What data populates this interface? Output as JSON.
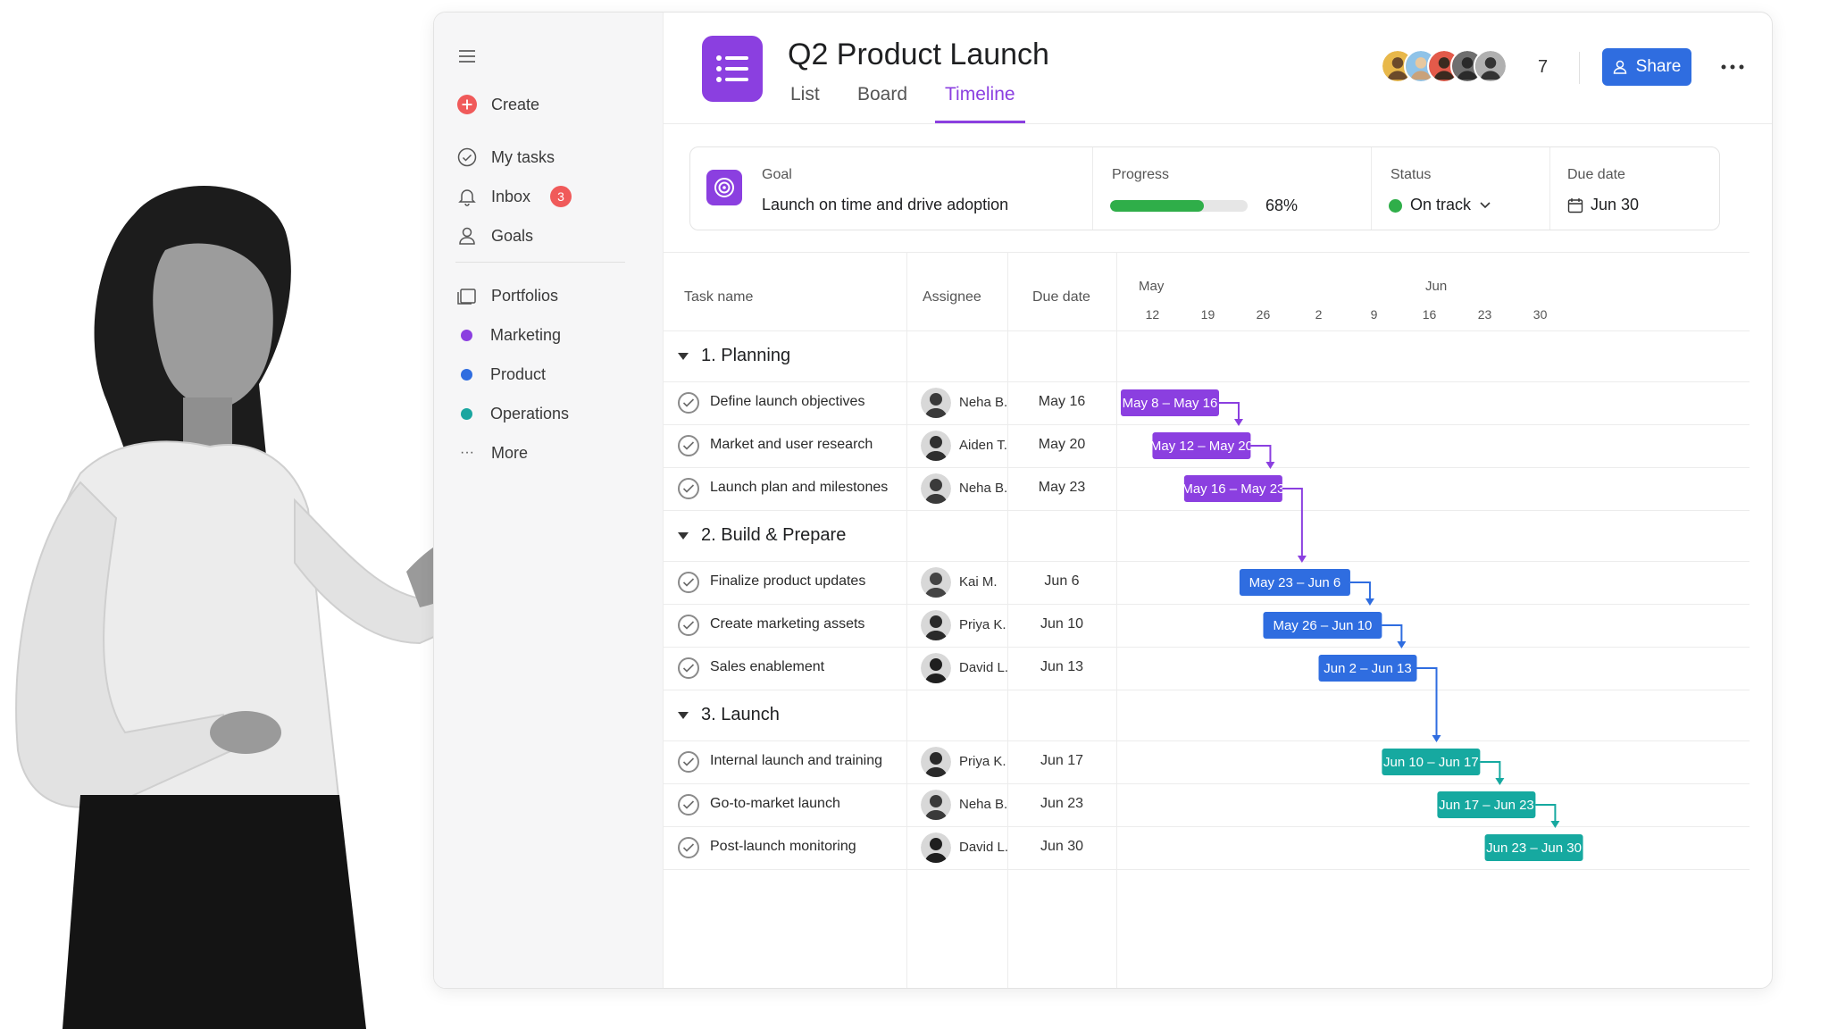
{
  "sidebar": {
    "create_label": "Create",
    "nav": [
      {
        "label": "My tasks",
        "icon": "check-circle-icon"
      },
      {
        "label": "Inbox",
        "icon": "bell-icon",
        "badge": "3"
      },
      {
        "label": "Goals",
        "icon": "person-icon"
      }
    ],
    "portfolios_label": "Portfolios",
    "teams": [
      {
        "label": "Marketing",
        "color": "#8b3fe0"
      },
      {
        "label": "Product",
        "color": "#2f6de0"
      },
      {
        "label": "Operations",
        "color": "#1aa6a0"
      }
    ],
    "more_label": "More"
  },
  "header": {
    "title": "Q2 Product Launch",
    "tabs": [
      "List",
      "Board",
      "Timeline"
    ],
    "active_tab": "Timeline",
    "member_count": "7",
    "share_label": "Share"
  },
  "goal_card": {
    "goal_label": "Goal",
    "goal_value": "Launch on time and drive adoption",
    "progress_label": "Progress",
    "progress_percent": 68,
    "progress_text": "68%",
    "status_label": "Status",
    "status_value": "On track",
    "due_label": "Due date",
    "due_value": "Jun 30"
  },
  "table": {
    "headers": {
      "task": "Task name",
      "assignee": "Assignee",
      "due": "Due date"
    },
    "months": [
      "May",
      "Jun"
    ],
    "day_ticks": [
      "12",
      "19",
      "26",
      "2",
      "9",
      "16",
      "23",
      "30"
    ],
    "sections": [
      {
        "title": "1. Planning",
        "color": "#8b3fe0",
        "tasks": [
          {
            "name": "Define launch objectives",
            "assignee": "Neha B.",
            "due": "May 16",
            "range": "May 8 – May 16"
          },
          {
            "name": "Market and user research",
            "assignee": "Aiden T.",
            "due": "May 20",
            "range": "May 12 – May 20"
          },
          {
            "name": "Launch plan and milestones",
            "assignee": "Neha B.",
            "due": "May 23",
            "range": "May 16 – May 23"
          }
        ]
      },
      {
        "title": "2. Build & Prepare",
        "color": "#2f6de0",
        "tasks": [
          {
            "name": "Finalize product updates",
            "assignee": "Kai M.",
            "due": "Jun 6",
            "range": "May 23 – Jun 6"
          },
          {
            "name": "Create marketing assets",
            "assignee": "Priya K.",
            "due": "Jun 10",
            "range": "May 26 – Jun 10"
          },
          {
            "name": "Sales enablement",
            "assignee": "David L.",
            "due": "Jun 13",
            "range": "Jun 2 – Jun 13"
          }
        ]
      },
      {
        "title": "3. Launch",
        "color": "#16a9a0",
        "tasks": [
          {
            "name": "Internal launch and training",
            "assignee": "Priya K.",
            "due": "Jun 17",
            "range": "Jun 10 – Jun 17"
          },
          {
            "name": "Go-to-market launch",
            "assignee": "Neha B.",
            "due": "Jun 23",
            "range": "Jun 17 – Jun 23"
          },
          {
            "name": "Post-launch monitoring",
            "assignee": "David L.",
            "due": "Jun 30",
            "range": "Jun 23 – Jun 30"
          }
        ]
      }
    ]
  }
}
